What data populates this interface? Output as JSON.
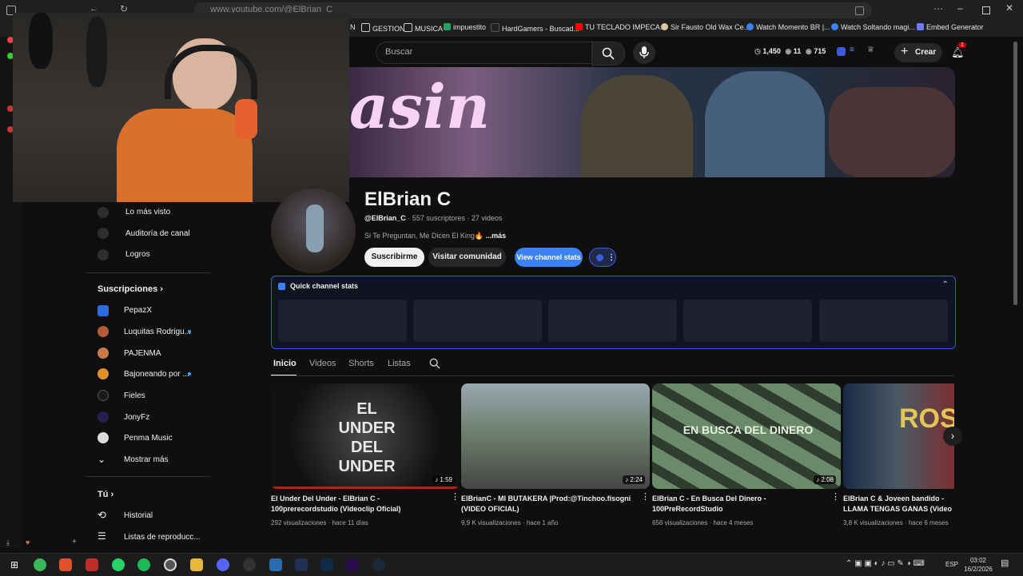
{
  "browser": {
    "url": "www.youtube.com/@ElBrian_C",
    "bookmarks": [
      "GESTION",
      "MUSICA",
      "impuestito",
      "HardGamers - Buscad...",
      "TU TECLADO IMPECA...",
      "Sir Fausto Old Wax Ce...",
      "Watch Momento BR |...",
      "Watch Soltando magi...",
      "Embed Generator"
    ]
  },
  "header": {
    "search_placeholder": "Buscar",
    "stats": [
      "1,450",
      "11",
      "715"
    ],
    "create_label": "Crear",
    "notif_count": "1"
  },
  "channel": {
    "name": "ElBrian C",
    "handle": "@ElBrian_C",
    "meta": "· 557 suscriptores · 27 videos",
    "description": "Si Te Preguntan, Me Dicen El King🔥",
    "more": "...más",
    "subscribe_label": "Suscribirme",
    "community_label": "Visitar comunidad",
    "stats_label": "View channel stats"
  },
  "quick_stats": {
    "title": "Quick channel stats"
  },
  "tabs": [
    "Inicio",
    "Videos",
    "Shorts",
    "Listas"
  ],
  "sidebar": {
    "top_items": [
      "Lo más visto",
      "Auditoría de canal",
      "Logros"
    ],
    "subs_heading": "Suscripciones",
    "subs": [
      "PepazX",
      "Luquitas Rodrigu...",
      "PAJENMA",
      "Bajoneando por ...",
      "Fieles",
      "JonyFz",
      "Penma Music"
    ],
    "show_more": "Mostrar más",
    "you_heading": "Tú",
    "you_items": [
      "Historial",
      "Listas de reproducc..."
    ]
  },
  "videos": [
    {
      "title": "El Under Del Under - ElBrian C - 100prerecordstudio (Videoclip Oficial)",
      "meta": "292 visualizaciones · hace 11 días",
      "duration": "1:59"
    },
    {
      "title": "ElBrianC - MI BUTAKERA |Prod:@Tinchoo.fisogni (VIDEO OFICIAL)",
      "meta": "9,9 K visualizaciones · hace 1 año",
      "duration": "2:24"
    },
    {
      "title": "ElBrian C - En Busca Del Dinero - 100PreRecordStudio",
      "meta": "656 visualizaciones · hace 4 meses",
      "duration": "2:08"
    },
    {
      "title": "ElBrian C & Joveen bandido - LLAMA TENGAS GANAS (Video Oficial)",
      "meta": "3,8 K visualizaciones · hace 6 meses",
      "duration": ""
    }
  ],
  "taskbar": {
    "lang": "ESP",
    "time": "03:02",
    "date": "16/2/2026"
  }
}
